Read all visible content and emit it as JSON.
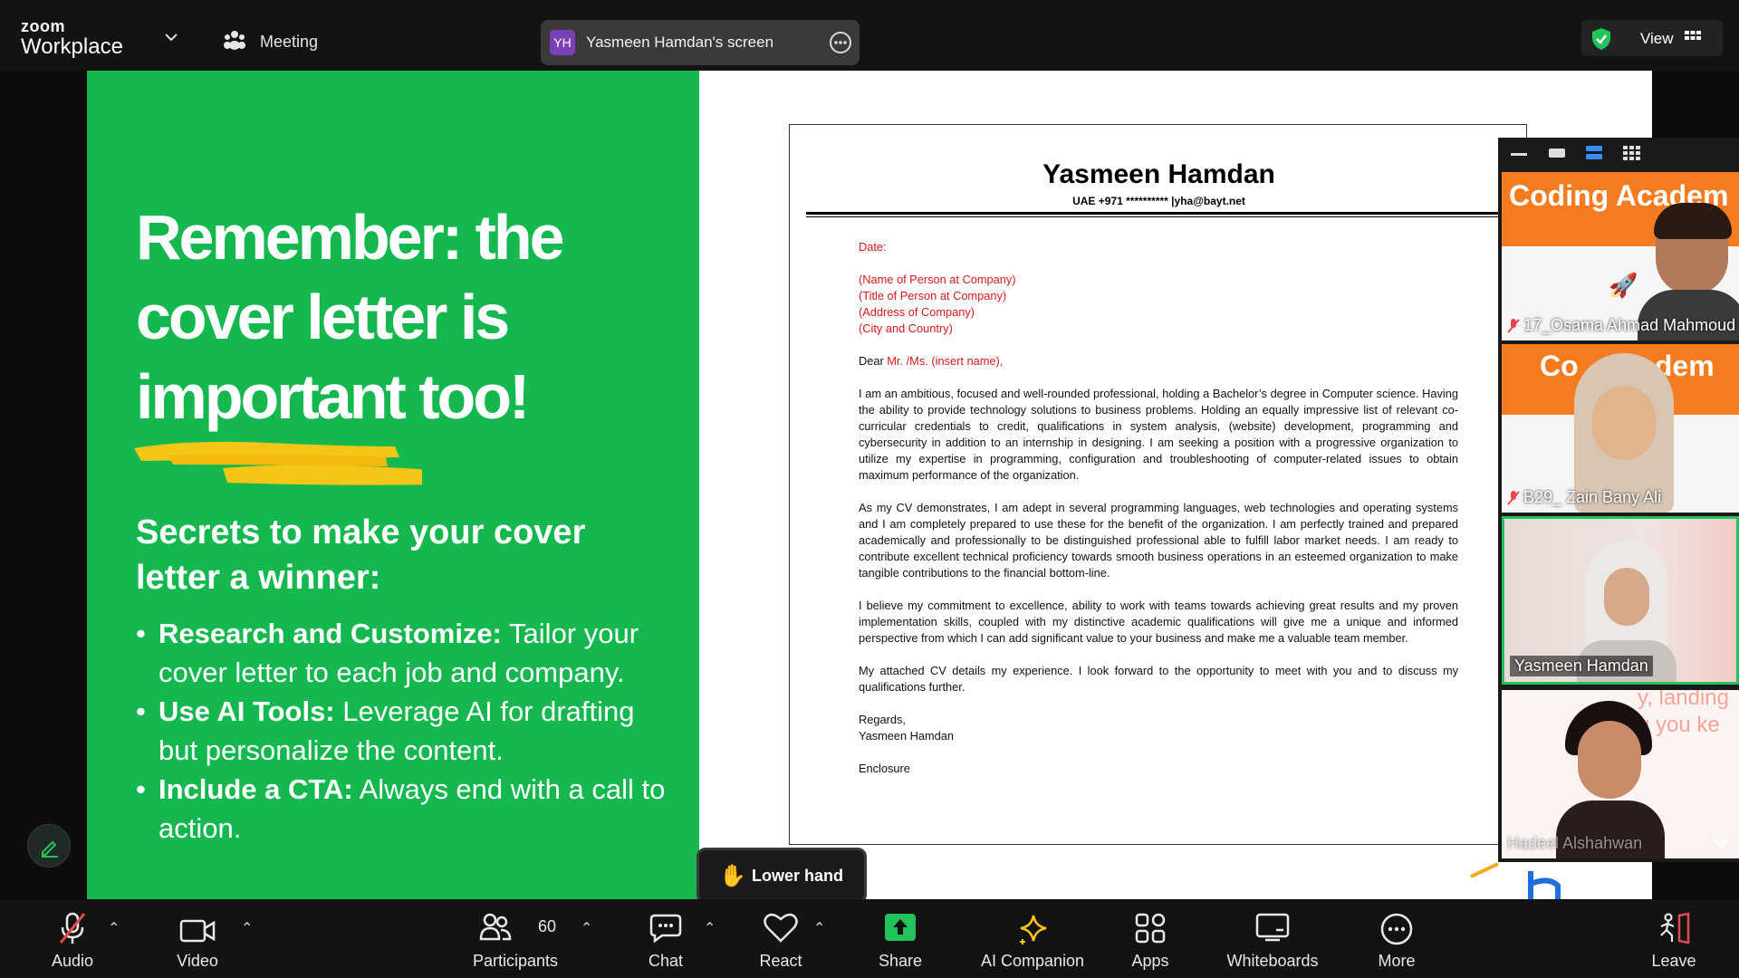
{
  "app": {
    "logo_small": "zoom",
    "logo_big": "Workplace",
    "meeting_label": "Meeting"
  },
  "share": {
    "initials": "YH",
    "label": "Yasmeen Hamdan's screen"
  },
  "view": {
    "label": "View"
  },
  "slide": {
    "headline": [
      "Remember: the",
      "cover letter is",
      "important too!"
    ],
    "subhead": "Secrets to make your cover letter a winner:",
    "bullets": [
      {
        "bold": "Research and Customize:",
        "text": " Tailor your cover letter to each job and company."
      },
      {
        "bold": "Use AI Tools:",
        "text": " Leverage AI for drafting but personalize the content."
      },
      {
        "bold": "Include a CTA:",
        "text": " Always end with a call to action."
      }
    ]
  },
  "document": {
    "name": "Yasmeen Hamdan",
    "contact": "UAE +971 **********  |yha@bayt.net",
    "date_label": "Date:",
    "recipient": [
      "(Name of Person at Company)",
      "(Title of Person at Company)",
      "(Address of Company)",
      "(City and Country)"
    ],
    "salutation_prefix": "Dear ",
    "salutation_red": "Mr. /Ms. (insert name),",
    "paragraphs": [
      "I am an ambitious, focused and well-rounded professional, holding a Bachelor’s degree in Computer science. Having the ability to provide technology solutions to business problems. Holding an equally impressive list of relevant co-curricular credentials to credit, qualifications in system analysis, (website) development, programming and cybersecurity in addition to an internship in designing. I am seeking a position with a progressive organization to utilize my expertise in programming, configuration and troubleshooting of computer-related issues to obtain maximum performance of the organization.",
      "As my CV demonstrates, I am adept in several programming languages, web technologies and operating systems and I am completely prepared to use these for the benefit of the organization. I am perfectly trained and prepared academically and professionally to be distinguished professional able to fulfill labor market needs. I am ready to contribute excellent technical proficiency towards smooth business operations in an esteemed organization to make tangible contributions to the financial bottom-line.",
      "I believe my commitment to excellence, ability to work with teams towards achieving great results and my proven implementation skills, coupled with my distinctive academic qualifications will give me a unique and informed perspective from which I can add significant value to your business and make me a valuable team member.",
      "My attached CV details my experience. I look forward to the opportunity to meet with you and to discuss my qualifications further."
    ],
    "closing": "Regards,",
    "signature": "Yasmeen Hamdan",
    "enclosure": "Enclosure"
  },
  "participants": [
    {
      "name": "17_Osama Ahmad Mahmoud",
      "muted": true,
      "banner": "Coding Academ"
    },
    {
      "name": "B29_ Zain Bany Ali",
      "muted": true,
      "banner": "Co   Academ"
    },
    {
      "name": "Yasmeen Hamdan",
      "muted": false,
      "active": true
    },
    {
      "name": "Hadeel Alshahwan",
      "muted": false,
      "bg_text": "y, landing\ng you ke"
    }
  ],
  "lower_hand": {
    "label": "Lower hand"
  },
  "toolbar": {
    "audio": "Audio",
    "video": "Video",
    "participants": "Participants",
    "participants_count": "60",
    "chat": "Chat",
    "react": "React",
    "share": "Share",
    "ai": "AI Companion",
    "apps": "Apps",
    "whiteboards": "Whiteboards",
    "more": "More",
    "leave": "Leave"
  },
  "colors": {
    "slide_green": "#15b84f",
    "highlight_yellow": "#f5c518",
    "share_green": "#21c35a",
    "leave_red": "#e5484d",
    "tile_orange": "#f47b20"
  }
}
